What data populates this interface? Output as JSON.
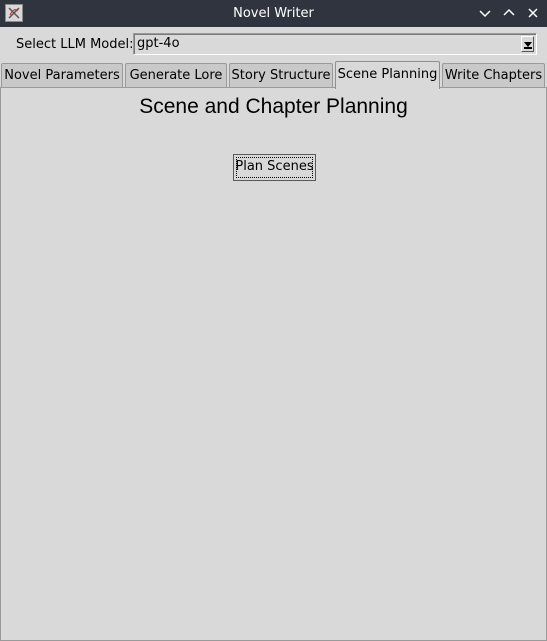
{
  "window": {
    "title": "Novel Writer"
  },
  "model_selector": {
    "label": "Select LLM Model:",
    "value": "gpt-4o"
  },
  "tabs": [
    {
      "label": "Novel Parameters"
    },
    {
      "label": "Generate Lore"
    },
    {
      "label": "Story Structure"
    },
    {
      "label": "Scene Planning",
      "active": true
    },
    {
      "label": "Write Chapters"
    }
  ],
  "panel": {
    "title": "Scene and Chapter Planning",
    "plan_button_label": "Plan Scenes"
  },
  "colors": {
    "titlebar_bg": "#2f343f",
    "window_bg": "#d9d9d9",
    "inactive_tab_bg": "#c9c9c9"
  },
  "icons": {
    "app": "app-icon",
    "minimize": "chevron-down-icon",
    "maximize": "chevron-up-icon",
    "close": "close-icon",
    "dropdown": "dropdown-arrow-icon"
  }
}
